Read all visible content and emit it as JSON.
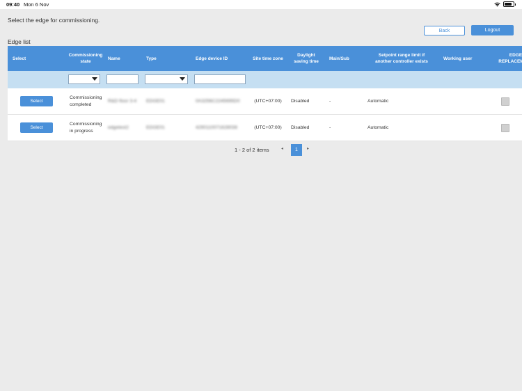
{
  "status_bar": {
    "time": "09:40",
    "date": "Mon 6 Nov"
  },
  "instruction": "Select the edge for commissioning.",
  "buttons": {
    "back": "Back",
    "logout": "Logout"
  },
  "section_title": "Edge list",
  "columns": {
    "select": "Select",
    "commissioning_state": "Commissioning state",
    "name": "Name",
    "type": "Type",
    "edge_device_id": "Edge device ID",
    "site_time_zone": "Site time zone",
    "daylight_saving_time": "Daylight saving time",
    "main_sub": "Main/Sub",
    "setpoint_range": "Setpoint range limit if another controller exists",
    "working_user": "Working user",
    "edge_replacement": "EDGE REPLACEMENT"
  },
  "rows": [
    {
      "select_label": "Select",
      "state": "Commissioning completed",
      "name": "R&D floor 3-4",
      "type": "EDGE01",
      "edge_device_id": "0A3256C2245695D0",
      "time_zone": "(UTC+07:00)",
      "dst": "Disabled",
      "main_sub": "-",
      "setpoint": "Automatic"
    },
    {
      "select_label": "Select",
      "state": "Commissioning in progress",
      "name": "edgetest2",
      "type": "EDGE01",
      "edge_device_id": "4290110071628038",
      "time_zone": "(UTC+07:00)",
      "dst": "Disabled",
      "main_sub": "-",
      "setpoint": "Automatic"
    }
  ],
  "pager": {
    "info": "1 - 2 of 2 items",
    "current_page": "1",
    "prev": "◂",
    "next": "▸"
  },
  "colors": {
    "accent": "#4a90d9",
    "filter_row": "#c5dff2",
    "background": "#ebebeb"
  }
}
